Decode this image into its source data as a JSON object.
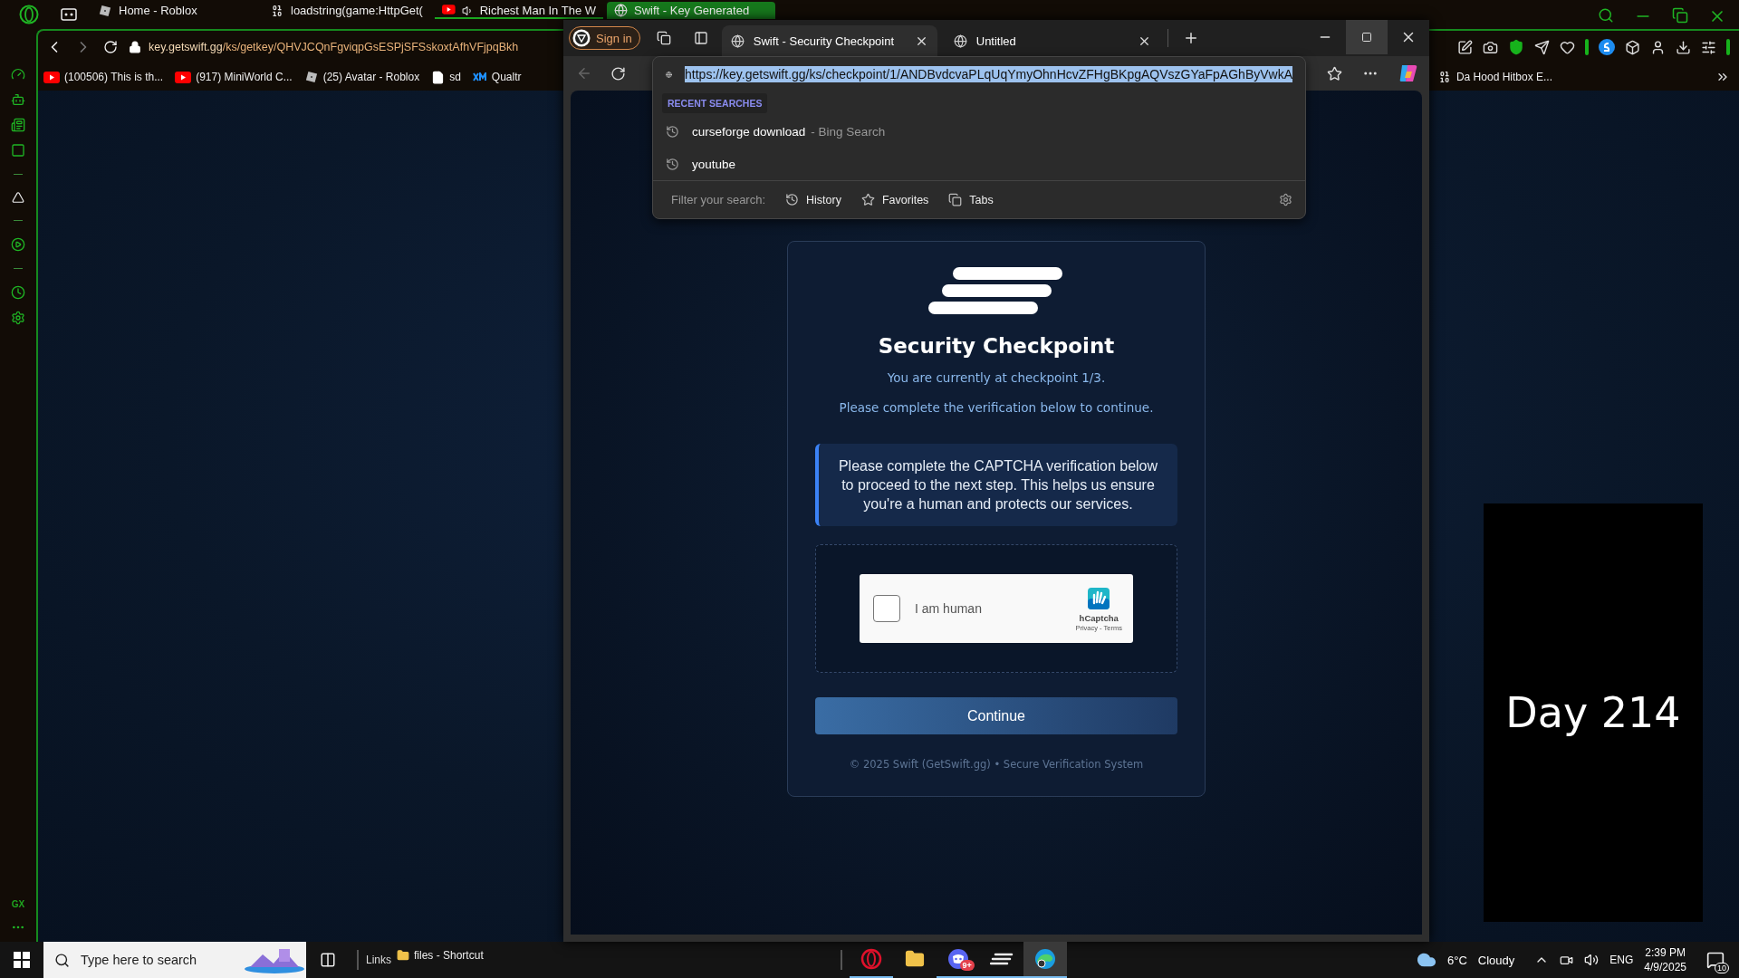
{
  "opera": {
    "tabs": [
      {
        "kind": "roblox",
        "label": "Home - Roblox",
        "selected": false,
        "playing": false
      },
      {
        "kind": "code",
        "label": "loadstring(game:HttpGet(",
        "selected": false,
        "playing": false
      },
      {
        "kind": "youtube",
        "label": "Richest Man In The W",
        "selected": false,
        "playing": true
      },
      {
        "kind": "globe",
        "label": "Swift - Key Generated",
        "selected": true,
        "playing": false
      }
    ],
    "address": {
      "domain": "key.getswift.gg",
      "path": "/ks/getkey/QHVJCQnFgviqpGsESPjSFSskoxtAfhVFjpqBkh"
    },
    "bookmarks": [
      {
        "kind": "youtube",
        "label": "(100506) This is th..."
      },
      {
        "kind": "youtube",
        "label": "(917) MiniWorld C..."
      },
      {
        "kind": "roblox",
        "label": "(25) Avatar - Roblox"
      },
      {
        "kind": "file",
        "label": "sd"
      },
      {
        "kind": "xm",
        "label": "Qualtr"
      }
    ],
    "bookmarks_right": [
      {
        "kind": "code",
        "label": "Da Hood Hitbox E..."
      }
    ],
    "sidebar_footer": "GX"
  },
  "edge": {
    "sign_in": "Sign in",
    "tabs": [
      {
        "label": "Swift - Security Checkpoint",
        "selected": true
      },
      {
        "label": "Untitled",
        "selected": false
      }
    ],
    "back_disabled": true,
    "dropdown": {
      "url": "https://key.getswift.gg/ks/checkpoint/1/ANDBvdcvaPLqUqYmyOhnHcvZFHgBKpgAQVszGYaFpAGhByVwkA",
      "heading": "RECENT SEARCHES",
      "items": [
        {
          "query": "curseforge download",
          "source": "- Bing Search"
        },
        {
          "query": "youtube"
        }
      ],
      "filter_label": "Filter your search:",
      "filters": [
        {
          "kind": "history",
          "label": "History"
        },
        {
          "kind": "favorites",
          "label": "Favorites"
        },
        {
          "kind": "tabs",
          "label": "Tabs"
        }
      ]
    },
    "page": {
      "title": "Security Checkpoint",
      "subtitle": "You are currently at checkpoint 1/3.",
      "instruction": "Please complete the verification below to continue.",
      "notice": "Please complete the CAPTCHA verification below to proceed to the next step. This helps us ensure you're a human and protects our services.",
      "captcha": {
        "label": "I am human",
        "checked": false,
        "brand": "hCaptcha",
        "links": "Privacy - Terms"
      },
      "button": "Continue",
      "footer": "© 2025 Swift (GetSwift.gg) • Secure Verification System"
    }
  },
  "overlay": {
    "text": "Day 214"
  },
  "taskbar": {
    "search_placeholder": "Type here to search",
    "toolbar_label": "Links",
    "shortcut": "files - Shortcut",
    "apps": [
      {
        "kind": "opera",
        "running": true,
        "selected": false
      },
      {
        "kind": "explorer",
        "running": false,
        "selected": false
      },
      {
        "kind": "discord",
        "running": true,
        "selected": false,
        "badge": "9+"
      },
      {
        "kind": "stripes",
        "running": true,
        "selected": false
      },
      {
        "kind": "edge",
        "running": true,
        "selected": true
      }
    ],
    "weather": {
      "temp": "6°C",
      "condition": "Cloudy"
    },
    "language": "ENG",
    "time": "2:39 PM",
    "date": "4/9/2025",
    "notifications": "10"
  }
}
